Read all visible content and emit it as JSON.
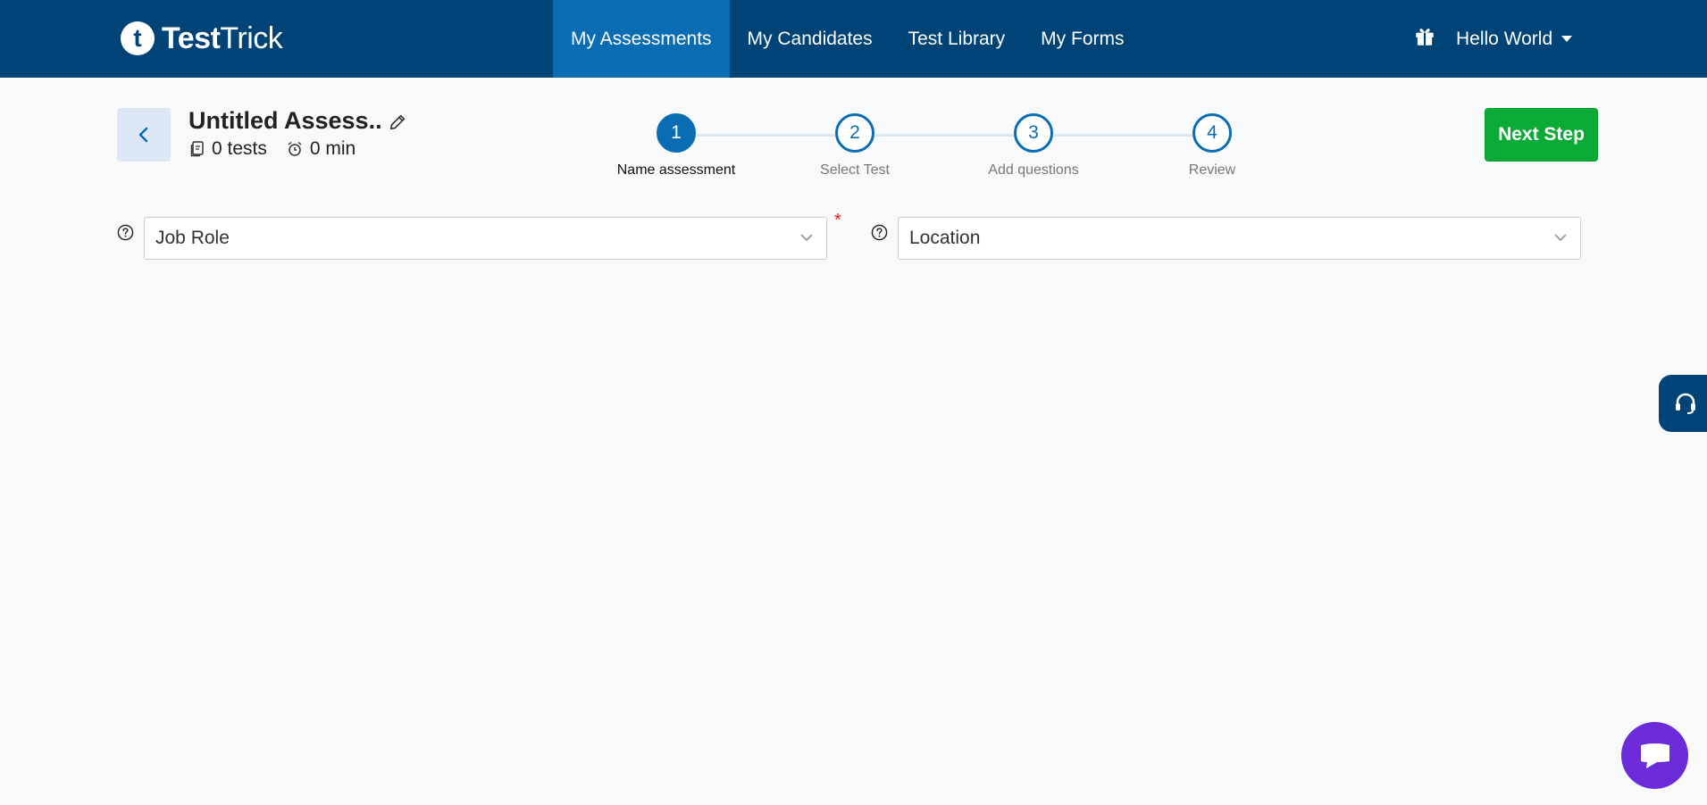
{
  "brand": {
    "logo_letter": "t",
    "name_bold": "Test",
    "name_light": "Trick"
  },
  "nav": {
    "items": [
      {
        "label": "My Assessments",
        "active": true
      },
      {
        "label": "My Candidates"
      },
      {
        "label": "Test Library"
      },
      {
        "label": "My Forms"
      }
    ],
    "user_label": "Hello World"
  },
  "assessment": {
    "title": "Untitled Assess..",
    "tests_count": "0 tests",
    "duration": "0 min"
  },
  "stepper": {
    "steps": [
      {
        "number": "1",
        "label": "Name assessment",
        "active": true
      },
      {
        "number": "2",
        "label": "Select Test"
      },
      {
        "number": "3",
        "label": "Add questions"
      },
      {
        "number": "4",
        "label": "Review"
      }
    ]
  },
  "actions": {
    "next_label": "Next Step"
  },
  "form": {
    "job_role_placeholder": "Job Role",
    "required_marker": "*",
    "location_placeholder": "Location"
  },
  "colors": {
    "nav_bg": "#004477",
    "nav_active": "#0a6db3",
    "next_button": "#0aaa36",
    "chat_button": "#6c2bd9",
    "required": "#e01b1b"
  },
  "icons": {
    "back": "chevron-left-icon",
    "edit": "pencil-icon",
    "tests": "document-icon",
    "duration": "alarm-clock-icon",
    "gift": "gift-icon",
    "help": "question-circle-icon",
    "dropdown": "chevron-down-icon",
    "support": "headset-icon",
    "chat": "chat-icon"
  }
}
